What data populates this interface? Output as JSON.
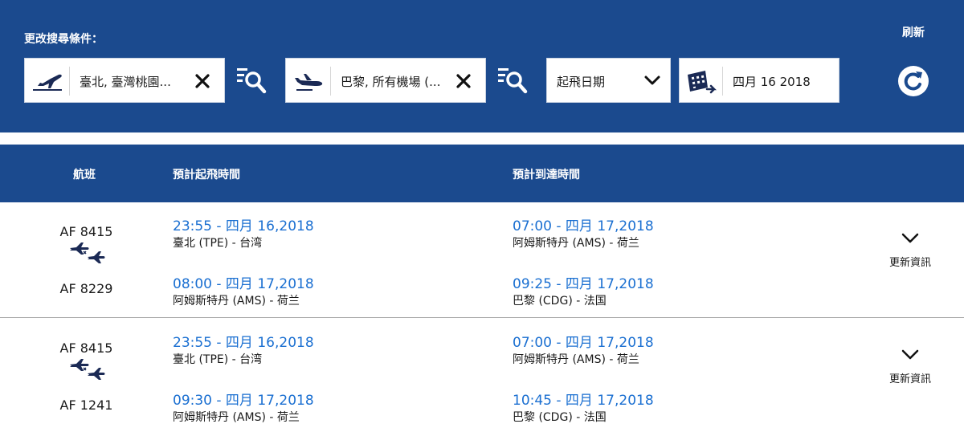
{
  "search": {
    "title": "更改搜尋條件：",
    "origin_value": "臺北, 臺灣桃園...",
    "destination_value": "巴黎, 所有機場 (...",
    "date_type": "起飛日期",
    "date_value": "四月 16 2018",
    "refresh_label": "刷新"
  },
  "table": {
    "col_flight": "航班",
    "col_departure": "預計起飛時間",
    "col_arrival": "預計到達時間"
  },
  "results": [
    {
      "flight1": "AF 8415",
      "flight2": "AF 8229",
      "leg1_dep_time": "23:55 - 四月 16,2018",
      "leg1_dep_place": "臺北 (TPE) - 台湾",
      "leg1_arr_time": "07:00 - 四月 17,2018",
      "leg1_arr_place": "阿姆斯特丹 (AMS) - 荷兰",
      "leg2_dep_time": "08:00 - 四月 17,2018",
      "leg2_dep_place": "阿姆斯特丹 (AMS) - 荷兰",
      "leg2_arr_time": "09:25 - 四月 17,2018",
      "leg2_arr_place": "巴黎 (CDG) - 法国",
      "update_label": "更新資訊"
    },
    {
      "flight1": "AF 8415",
      "flight2": "AF 1241",
      "leg1_dep_time": "23:55 - 四月 16,2018",
      "leg1_dep_place": "臺北 (TPE) - 台湾",
      "leg1_arr_time": "07:00 - 四月 17,2018",
      "leg1_arr_place": "阿姆斯特丹 (AMS) - 荷兰",
      "leg2_dep_time": "09:30 - 四月 17,2018",
      "leg2_dep_place": "阿姆斯特丹 (AMS) - 荷兰",
      "leg2_arr_time": "10:45 - 四月 17,2018",
      "leg2_arr_place": "巴黎 (CDG) - 法国",
      "update_label": "更新資訊"
    }
  ],
  "icons": {
    "takeoff": "takeoff-icon",
    "landing": "landing-icon",
    "clear": "close-icon",
    "search_list": "search-list-icon",
    "chevron": "chevron-down-icon",
    "calendar": "calendar-icon",
    "refresh": "refresh-icon",
    "connection": "connecting-flights-icon"
  },
  "colors": {
    "brand_blue": "#1b4a8e",
    "link_blue": "#1a6fd1",
    "icon_navy": "#1b2a55"
  }
}
